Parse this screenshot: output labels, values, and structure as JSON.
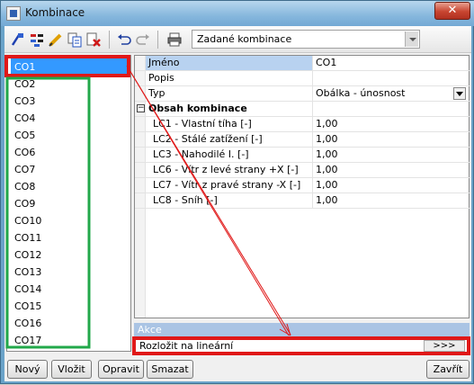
{
  "window": {
    "title": "Kombinace",
    "close_label": "✕"
  },
  "toolbar": {
    "icons": [
      "properties-icon",
      "select-icon",
      "edit-icon",
      "copy-icon",
      "delete-icon",
      "undo-icon",
      "redo-icon",
      "print-icon"
    ],
    "combo_value": "Zadané kombinace"
  },
  "list": {
    "items": [
      "CO1",
      "CO2",
      "CO3",
      "CO4",
      "CO5",
      "CO6",
      "CO7",
      "CO8",
      "CO9",
      "CO10",
      "CO11",
      "CO12",
      "CO13",
      "CO14",
      "CO15",
      "CO16",
      "CO17"
    ],
    "selected": "CO1"
  },
  "props": {
    "name_key": "Jméno",
    "name_val": "CO1",
    "desc_key": "Popis",
    "desc_val": "",
    "type_key": "Typ",
    "type_val": "Obálka - únosnost",
    "group_label": "Obsah kombinace",
    "rows": [
      {
        "key": "LC1 - Vlastní tíha [-]",
        "val": "1,00"
      },
      {
        "key": "LC2 - Stálé zatížení [-]",
        "val": "1,00"
      },
      {
        "key": "LC3 - Nahodilé I. [-]",
        "val": "1,00"
      },
      {
        "key": "LC6 - Vítr z levé strany +X [-]",
        "val": "1,00"
      },
      {
        "key": "LC7 - Vítr z pravé strany -X [-]",
        "val": "1,00"
      },
      {
        "key": "LC8 - Sníh [-]",
        "val": "1,00"
      }
    ]
  },
  "actions": {
    "header": "Akce",
    "row_label": "Rozložit na lineární",
    "row_button": ">>>"
  },
  "buttons": {
    "new": "Nový",
    "insert": "Vložit",
    "edit": "Opravit",
    "delete": "Smazat",
    "close": "Zavřít"
  },
  "colors": {
    "highlight_red": "#e01818",
    "highlight_green": "#22a84a",
    "selection_blue": "#3399ff"
  }
}
